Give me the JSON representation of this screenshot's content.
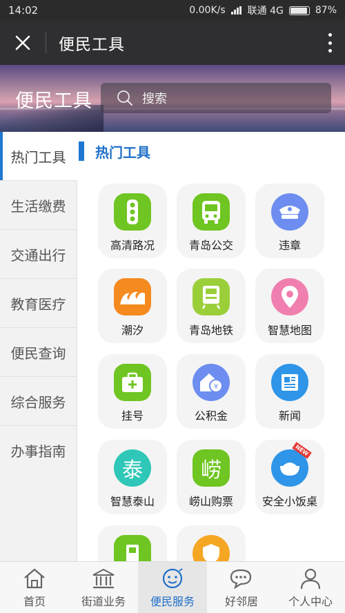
{
  "status_bar": {
    "time": "14:02",
    "network_speed": "0.00K/s",
    "carrier": "联通 4G",
    "battery": "87%"
  },
  "title_bar": {
    "title": "便民工具"
  },
  "banner": {
    "title": "便民工具",
    "search_placeholder": "搜索"
  },
  "sidebar": {
    "items": [
      {
        "label": "热门工具",
        "active": true
      },
      {
        "label": "生活缴费"
      },
      {
        "label": "交通出行"
      },
      {
        "label": "教育医疗"
      },
      {
        "label": "便民查询"
      },
      {
        "label": "综合服务"
      },
      {
        "label": "办事指南"
      }
    ]
  },
  "main": {
    "section_title": "热门工具",
    "tools": [
      {
        "label": "高清路况",
        "icon": "traffic-light-icon",
        "color": "#6fc521"
      },
      {
        "label": "青岛公交",
        "icon": "bus-icon",
        "color": "#6fc521"
      },
      {
        "label": "违章",
        "icon": "police-cap-icon",
        "color": "#6d8ef0"
      },
      {
        "label": "潮汐",
        "icon": "wave-icon",
        "color": "#f58a1f"
      },
      {
        "label": "青岛地铁",
        "icon": "subway-icon",
        "color": "#9bcf3a"
      },
      {
        "label": "智慧地图",
        "icon": "map-pin-icon",
        "color": "#f07eae"
      },
      {
        "label": "挂号",
        "icon": "medical-kit-icon",
        "color": "#6fc521"
      },
      {
        "label": "公积金",
        "icon": "housing-fund-icon",
        "color": "#6d8ef0"
      },
      {
        "label": "新闻",
        "icon": "newspaper-icon",
        "color": "#2e95e8"
      },
      {
        "label": "智慧泰山",
        "icon": "tai-character-icon",
        "color": "#2fc7b7",
        "glyph": "泰"
      },
      {
        "label": "崂山购票",
        "icon": "lao-character-icon",
        "color": "#6fc521",
        "glyph": "崂"
      },
      {
        "label": "安全小饭桌",
        "icon": "rice-bowl-icon",
        "color": "#2e95e8",
        "badge": "NEW"
      },
      {
        "label": "",
        "icon": "card-icon",
        "color": "#6fc521"
      },
      {
        "label": "",
        "icon": "shield-icon",
        "color": "#f5a623"
      }
    ]
  },
  "bottom_nav": {
    "items": [
      {
        "label": "首页",
        "icon": "home-icon"
      },
      {
        "label": "街道业务",
        "icon": "government-building-icon"
      },
      {
        "label": "便民服务",
        "icon": "smiley-service-icon",
        "active": true
      },
      {
        "label": "好邻居",
        "icon": "chat-bubbles-icon"
      },
      {
        "label": "个人中心",
        "icon": "person-icon"
      }
    ]
  },
  "colors": {
    "accent": "#1f77d2",
    "titlebar_bg": "#2f2f31"
  }
}
